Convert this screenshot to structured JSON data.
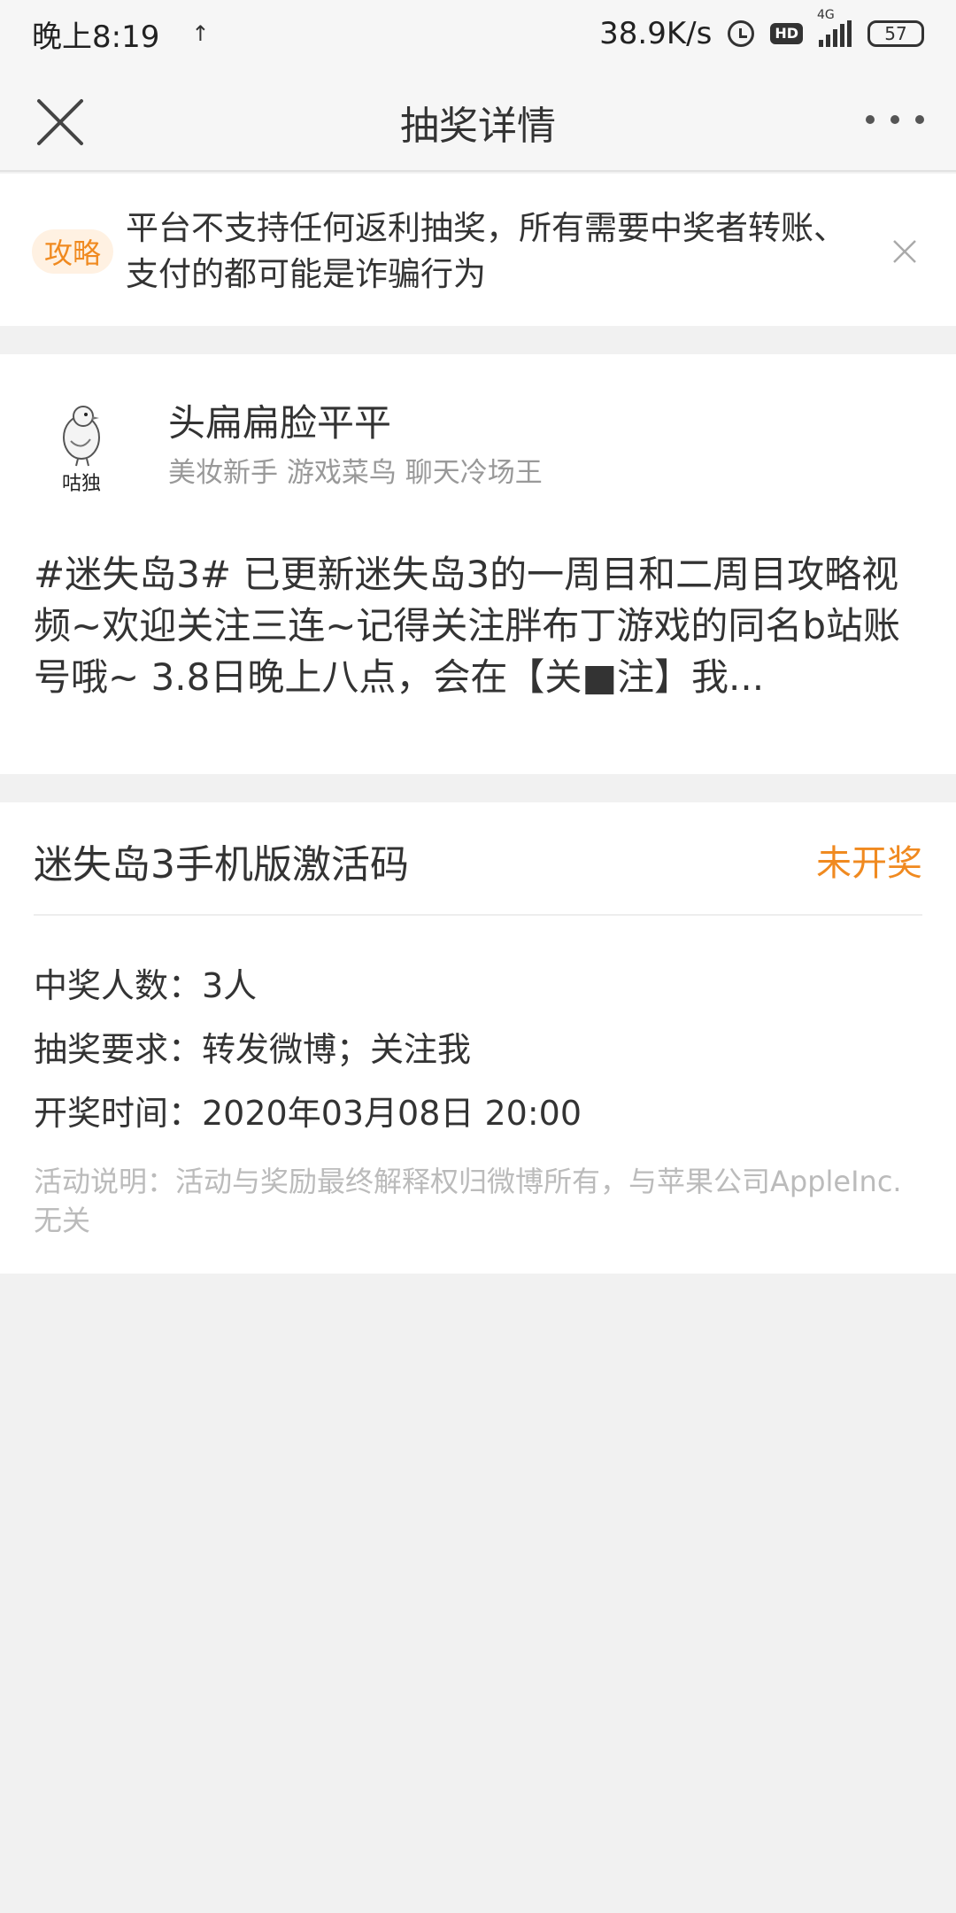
{
  "status_bar": {
    "time": "晚上8:19",
    "net_speed": "38.9K/s",
    "network_type": "4G",
    "battery": "57",
    "hd_label": "HD"
  },
  "nav": {
    "title": "抽奖详情"
  },
  "notice": {
    "tag": "攻略",
    "text": "平台不支持任何返利抽奖，所有需要中奖者转账、支付的都可能是诈骗行为"
  },
  "post": {
    "avatar_caption": "咕独",
    "user_name": "头扁扁脸平平",
    "user_tags": "美妆新手 游戏菜鸟 聊天冷场王",
    "content": "#迷失岛3# 已更新迷失岛3的一周目和二周目攻略视频~欢迎关注三连~记得关注胖布丁游戏的同名b站账号哦~ 3.8日晚上八点，会在【关■注】我..."
  },
  "lottery": {
    "prize_title": "迷失岛3手机版激活码",
    "status": "未开奖",
    "winners": "中奖人数：3人",
    "requirements": "抽奖要求：转发微博；关注我",
    "draw_time": "开奖时间：2020年03月08日 20:00",
    "note": "活动说明：活动与奖励最终解释权归微博所有，与苹果公司AppleInc.无关"
  },
  "colors": {
    "accent_orange": "#f08a20",
    "background_gray": "#f1f1f1",
    "muted_text": "#999999"
  }
}
